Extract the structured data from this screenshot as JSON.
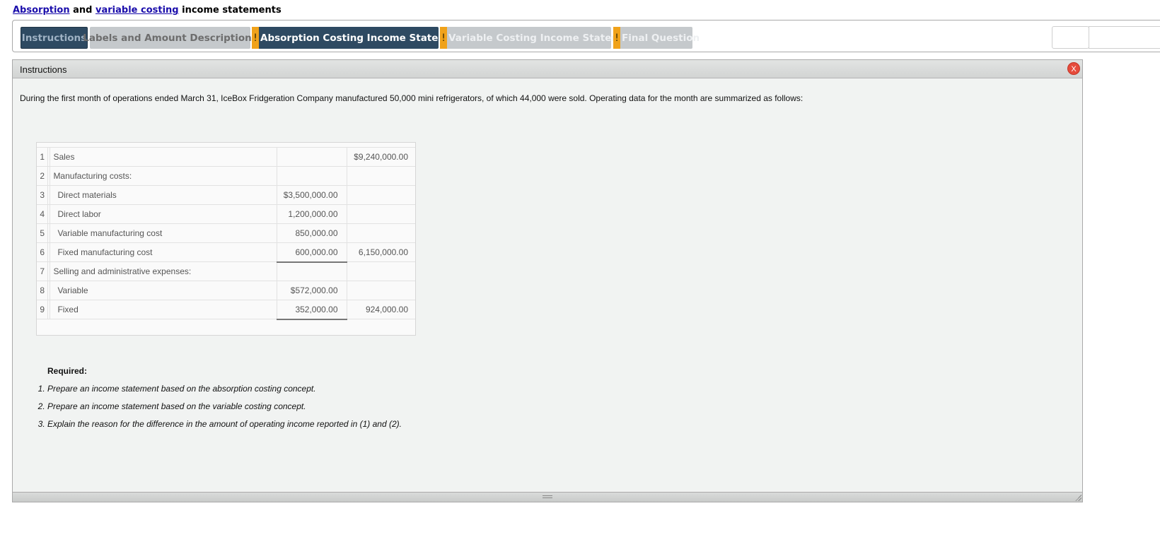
{
  "heading": {
    "link1": "Absorption",
    "text1": " and ",
    "link2": "variable costing",
    "text2": " income statements"
  },
  "tabs": {
    "instructions": "Instructions",
    "labels": "Labels and Amount Descriptions",
    "absorption": "Absorption Costing Income Statement",
    "variable": "Variable Costing Income Statement",
    "final": "Final Question",
    "warn_mark": "!"
  },
  "panel": {
    "title": "Instructions",
    "close": "X",
    "intro": "During the first month of operations ended March 31, IceBox Fridgeration Company manufactured 50,000 mini refrigerators, of which 44,000 were sold. Operating data for the month are summarized as follows:"
  },
  "table": {
    "rows": [
      {
        "num": "1",
        "label": "Sales",
        "amt1": "",
        "amt2": "$9,240,000.00"
      },
      {
        "num": "2",
        "label": "Manufacturing costs:",
        "amt1": "",
        "amt2": ""
      },
      {
        "num": "3",
        "label": "Direct materials",
        "amt1": "$3,500,000.00",
        "amt2": ""
      },
      {
        "num": "4",
        "label": "Direct labor",
        "amt1": "1,200,000.00",
        "amt2": ""
      },
      {
        "num": "5",
        "label": "Variable manufacturing cost",
        "amt1": "850,000.00",
        "amt2": ""
      },
      {
        "num": "6",
        "label": "Fixed manufacturing cost",
        "amt1": "600,000.00",
        "amt2": "6,150,000.00"
      },
      {
        "num": "7",
        "label": "Selling and administrative expenses:",
        "amt1": "",
        "amt2": ""
      },
      {
        "num": "8",
        "label": "Variable",
        "amt1": "$572,000.00",
        "amt2": ""
      },
      {
        "num": "9",
        "label": "Fixed",
        "amt1": "352,000.00",
        "amt2": "924,000.00"
      }
    ]
  },
  "required": {
    "title": "Required:",
    "items": [
      "Prepare an income statement based on the absorption costing concept.",
      "Prepare an income statement based on the variable costing concept.",
      "Explain the reason for the difference in the amount of operating income reported in (1) and (2)."
    ]
  }
}
